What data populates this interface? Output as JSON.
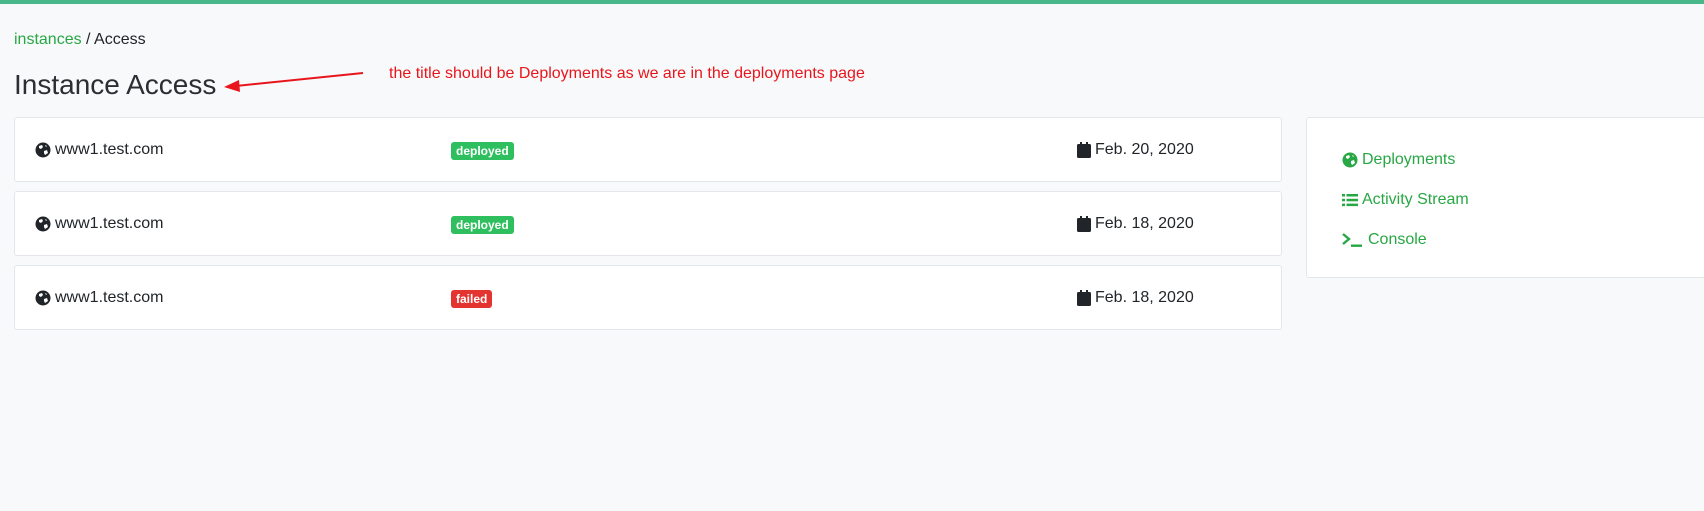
{
  "breadcrumb": {
    "link": "instances",
    "separator": " / ",
    "current": "Access"
  },
  "page_title": "Instance Access",
  "annotation": {
    "text": "the title should be Deployments as we are in the deployments page",
    "color": "#e8161c"
  },
  "deployments": [
    {
      "host": "www1.test.com",
      "status": "deployed",
      "status_color": "#2fbf5f",
      "date": "Feb. 20, 2020"
    },
    {
      "host": "www1.test.com",
      "status": "deployed",
      "status_color": "#2fbf5f",
      "date": "Feb. 18, 2020"
    },
    {
      "host": "www1.test.com",
      "status": "failed",
      "status_color": "#e3342f",
      "date": "Feb. 18, 2020"
    }
  ],
  "side_menu": [
    {
      "label": "Deployments",
      "icon": "globe-icon"
    },
    {
      "label": "Activity Stream",
      "icon": "list-icon"
    },
    {
      "label": "Console",
      "icon": "terminal-icon"
    }
  ],
  "colors": {
    "accent": "#28a745",
    "topbar": "#48b88a"
  }
}
